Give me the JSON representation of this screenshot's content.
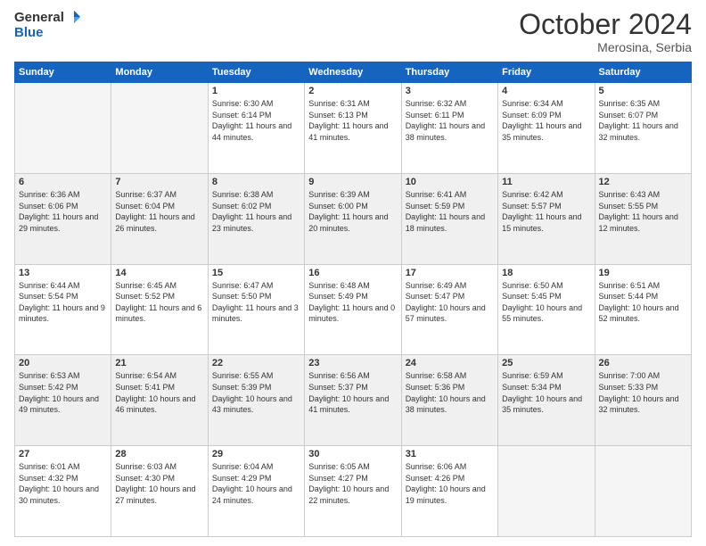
{
  "header": {
    "logo_general": "General",
    "logo_blue": "Blue",
    "title": "October 2024",
    "subtitle": "Merosina, Serbia"
  },
  "weekdays": [
    "Sunday",
    "Monday",
    "Tuesday",
    "Wednesday",
    "Thursday",
    "Friday",
    "Saturday"
  ],
  "weeks": [
    [
      {
        "day": "",
        "info": ""
      },
      {
        "day": "",
        "info": ""
      },
      {
        "day": "1",
        "info": "Sunrise: 6:30 AM\nSunset: 6:14 PM\nDaylight: 11 hours and 44 minutes."
      },
      {
        "day": "2",
        "info": "Sunrise: 6:31 AM\nSunset: 6:13 PM\nDaylight: 11 hours and 41 minutes."
      },
      {
        "day": "3",
        "info": "Sunrise: 6:32 AM\nSunset: 6:11 PM\nDaylight: 11 hours and 38 minutes."
      },
      {
        "day": "4",
        "info": "Sunrise: 6:34 AM\nSunset: 6:09 PM\nDaylight: 11 hours and 35 minutes."
      },
      {
        "day": "5",
        "info": "Sunrise: 6:35 AM\nSunset: 6:07 PM\nDaylight: 11 hours and 32 minutes."
      }
    ],
    [
      {
        "day": "6",
        "info": "Sunrise: 6:36 AM\nSunset: 6:06 PM\nDaylight: 11 hours and 29 minutes."
      },
      {
        "day": "7",
        "info": "Sunrise: 6:37 AM\nSunset: 6:04 PM\nDaylight: 11 hours and 26 minutes."
      },
      {
        "day": "8",
        "info": "Sunrise: 6:38 AM\nSunset: 6:02 PM\nDaylight: 11 hours and 23 minutes."
      },
      {
        "day": "9",
        "info": "Sunrise: 6:39 AM\nSunset: 6:00 PM\nDaylight: 11 hours and 20 minutes."
      },
      {
        "day": "10",
        "info": "Sunrise: 6:41 AM\nSunset: 5:59 PM\nDaylight: 11 hours and 18 minutes."
      },
      {
        "day": "11",
        "info": "Sunrise: 6:42 AM\nSunset: 5:57 PM\nDaylight: 11 hours and 15 minutes."
      },
      {
        "day": "12",
        "info": "Sunrise: 6:43 AM\nSunset: 5:55 PM\nDaylight: 11 hours and 12 minutes."
      }
    ],
    [
      {
        "day": "13",
        "info": "Sunrise: 6:44 AM\nSunset: 5:54 PM\nDaylight: 11 hours and 9 minutes."
      },
      {
        "day": "14",
        "info": "Sunrise: 6:45 AM\nSunset: 5:52 PM\nDaylight: 11 hours and 6 minutes."
      },
      {
        "day": "15",
        "info": "Sunrise: 6:47 AM\nSunset: 5:50 PM\nDaylight: 11 hours and 3 minutes."
      },
      {
        "day": "16",
        "info": "Sunrise: 6:48 AM\nSunset: 5:49 PM\nDaylight: 11 hours and 0 minutes."
      },
      {
        "day": "17",
        "info": "Sunrise: 6:49 AM\nSunset: 5:47 PM\nDaylight: 10 hours and 57 minutes."
      },
      {
        "day": "18",
        "info": "Sunrise: 6:50 AM\nSunset: 5:45 PM\nDaylight: 10 hours and 55 minutes."
      },
      {
        "day": "19",
        "info": "Sunrise: 6:51 AM\nSunset: 5:44 PM\nDaylight: 10 hours and 52 minutes."
      }
    ],
    [
      {
        "day": "20",
        "info": "Sunrise: 6:53 AM\nSunset: 5:42 PM\nDaylight: 10 hours and 49 minutes."
      },
      {
        "day": "21",
        "info": "Sunrise: 6:54 AM\nSunset: 5:41 PM\nDaylight: 10 hours and 46 minutes."
      },
      {
        "day": "22",
        "info": "Sunrise: 6:55 AM\nSunset: 5:39 PM\nDaylight: 10 hours and 43 minutes."
      },
      {
        "day": "23",
        "info": "Sunrise: 6:56 AM\nSunset: 5:37 PM\nDaylight: 10 hours and 41 minutes."
      },
      {
        "day": "24",
        "info": "Sunrise: 6:58 AM\nSunset: 5:36 PM\nDaylight: 10 hours and 38 minutes."
      },
      {
        "day": "25",
        "info": "Sunrise: 6:59 AM\nSunset: 5:34 PM\nDaylight: 10 hours and 35 minutes."
      },
      {
        "day": "26",
        "info": "Sunrise: 7:00 AM\nSunset: 5:33 PM\nDaylight: 10 hours and 32 minutes."
      }
    ],
    [
      {
        "day": "27",
        "info": "Sunrise: 6:01 AM\nSunset: 4:32 PM\nDaylight: 10 hours and 30 minutes."
      },
      {
        "day": "28",
        "info": "Sunrise: 6:03 AM\nSunset: 4:30 PM\nDaylight: 10 hours and 27 minutes."
      },
      {
        "day": "29",
        "info": "Sunrise: 6:04 AM\nSunset: 4:29 PM\nDaylight: 10 hours and 24 minutes."
      },
      {
        "day": "30",
        "info": "Sunrise: 6:05 AM\nSunset: 4:27 PM\nDaylight: 10 hours and 22 minutes."
      },
      {
        "day": "31",
        "info": "Sunrise: 6:06 AM\nSunset: 4:26 PM\nDaylight: 10 hours and 19 minutes."
      },
      {
        "day": "",
        "info": ""
      },
      {
        "day": "",
        "info": ""
      }
    ]
  ]
}
